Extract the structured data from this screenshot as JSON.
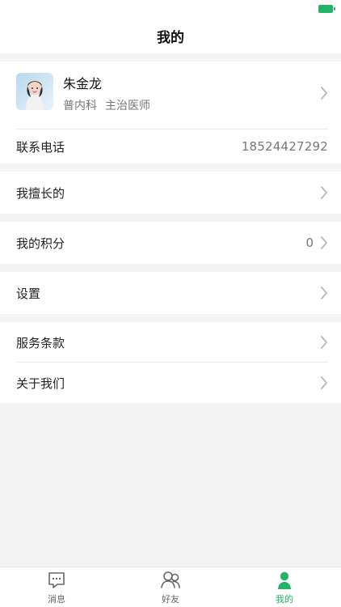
{
  "header": {
    "title": "我的"
  },
  "profile": {
    "name": "朱金龙",
    "department": "普内科",
    "role": "主治医师",
    "phone_label": "联系电话",
    "phone_value": "18524427292"
  },
  "menu": {
    "expertise_label": "我擅长的",
    "points_label": "我的积分",
    "points_value": "0",
    "settings_label": "设置",
    "terms_label": "服务条款",
    "about_label": "关于我们"
  },
  "bottom_nav": {
    "messages_label": "消息",
    "friends_label": "好友",
    "me_label": "我的"
  },
  "colors": {
    "accent": "#23b36a",
    "background": "#f4f4f4"
  },
  "icons": {
    "battery": "battery-icon",
    "chevron": "chevron-right-icon",
    "messages": "message-bubble-icon",
    "friends": "friends-icon",
    "me": "user-icon"
  }
}
